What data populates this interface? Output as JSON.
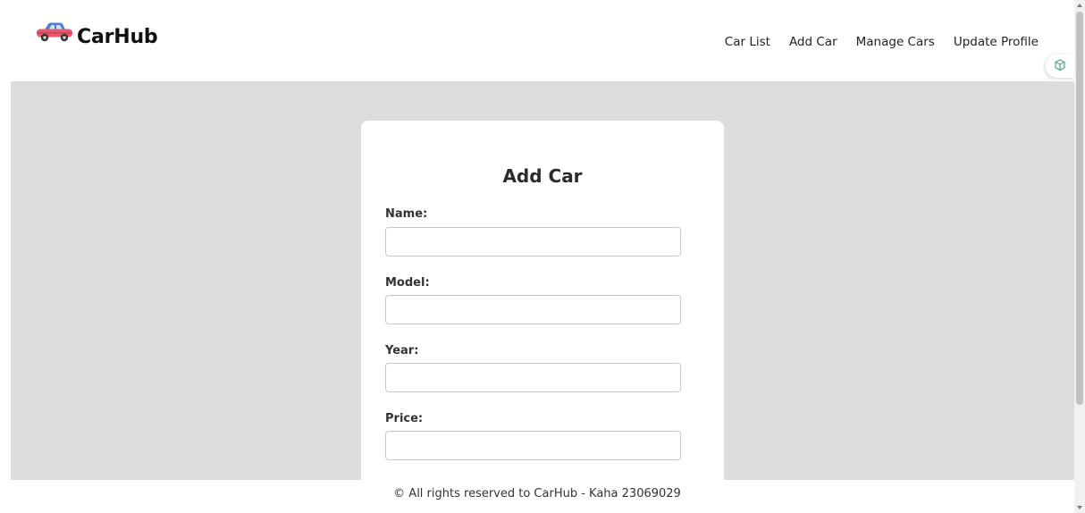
{
  "header": {
    "brand_icon": "car-icon",
    "brand_name": "CarHub",
    "nav": [
      {
        "label": "Car List"
      },
      {
        "label": "Add Car"
      },
      {
        "label": "Manage Cars"
      },
      {
        "label": "Update Profile"
      }
    ],
    "extension_icon": "extension-cube-icon"
  },
  "form": {
    "title": "Add Car",
    "fields": [
      {
        "label": "Name:",
        "value": ""
      },
      {
        "label": "Model:",
        "value": ""
      },
      {
        "label": "Year:",
        "value": ""
      },
      {
        "label": "Price:",
        "value": ""
      }
    ]
  },
  "footer": {
    "text": "© All rights reserved to CarHub - Kaha 23069029"
  },
  "colors": {
    "main_background": "#dcdcdc",
    "card_background": "#ffffff",
    "car_body": "#e8576a",
    "car_roof": "#4a7fd4"
  }
}
